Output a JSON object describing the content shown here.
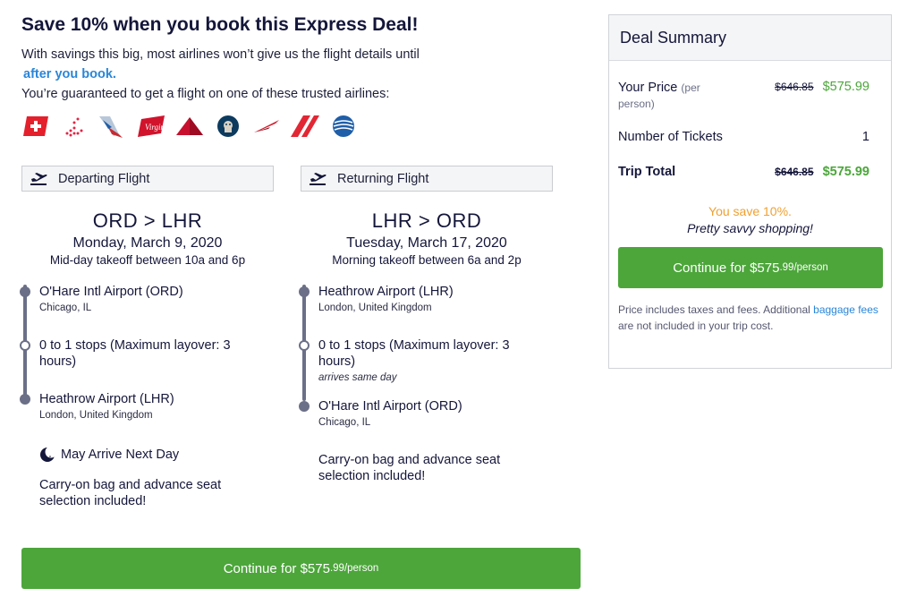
{
  "headline": "Save 10% when you book this Express Deal!",
  "intro": {
    "line1": "With savings this big, most airlines won’t give us the flight details until",
    "link": "after you book.",
    "line3": "You’re guaranteed to get a flight on one of these trusted airlines:"
  },
  "airlines": [
    {
      "name": "swiss-logo",
      "color": "#e4202c"
    },
    {
      "name": "latam-logo",
      "color": "#e32444"
    },
    {
      "name": "american-logo",
      "color": "#c62b33"
    },
    {
      "name": "virgin-logo",
      "color": "#d1132c"
    },
    {
      "name": "delta-logo",
      "color": "#c8102e"
    },
    {
      "name": "alaska-logo",
      "color": "#0c3b5f"
    },
    {
      "name": "aeromexico-logo",
      "color": "#d31e2f"
    },
    {
      "name": "airfrance-logo",
      "color": "#e22734"
    },
    {
      "name": "united-logo",
      "color": "#1f5ea8"
    }
  ],
  "departing": {
    "header": "Departing Flight",
    "route": "ORD > LHR",
    "date": "Monday, March 9, 2020",
    "takeoff": "Mid-day takeoff between 10a and 6p",
    "origin": {
      "name": "O'Hare Intl Airport (ORD)",
      "city": "Chicago, IL"
    },
    "stops": "0 to 1 stops (Maximum layover: 3 hours)",
    "destination": {
      "name": "Heathrow Airport (LHR)",
      "city": "London, United Kingdom"
    },
    "next_day": "May Arrive Next Day",
    "carryon": "Carry-on bag and advance seat selection included!"
  },
  "returning": {
    "header": "Returning Flight",
    "route": "LHR > ORD",
    "date": "Tuesday, March 17, 2020",
    "takeoff": "Morning takeoff between 6a and 2p",
    "origin": {
      "name": "Heathrow Airport (LHR)",
      "city": "London, United Kingdom"
    },
    "stops": "0 to 1 stops (Maximum layover: 3 hours)",
    "arrival_note": "arrives same day",
    "destination": {
      "name": "O'Hare Intl Airport (ORD)",
      "city": "Chicago, IL"
    },
    "carryon": "Carry-on bag and advance seat selection included!"
  },
  "cta": {
    "main": "Continue for $575",
    "cents": ".99/person"
  },
  "summary": {
    "title": "Deal Summary",
    "your_price_label": "Your Price",
    "per_person": "(per person)",
    "old_price": "$646.85",
    "new_price": "$575.99",
    "tickets_label": "Number of Tickets",
    "tickets_value": "1",
    "total_label": "Trip Total",
    "total_old": "$646.85",
    "total_new": "$575.99",
    "save_text": "You save 10%.",
    "savvy_text": "Pretty savvy shopping!",
    "cta_main": "Continue for $575",
    "cta_cents": ".99/person",
    "fine_print_1": "Price includes taxes and fees. Additional",
    "fine_link": "baggage fees",
    "fine_print_2": "are not included in your trip cost."
  }
}
